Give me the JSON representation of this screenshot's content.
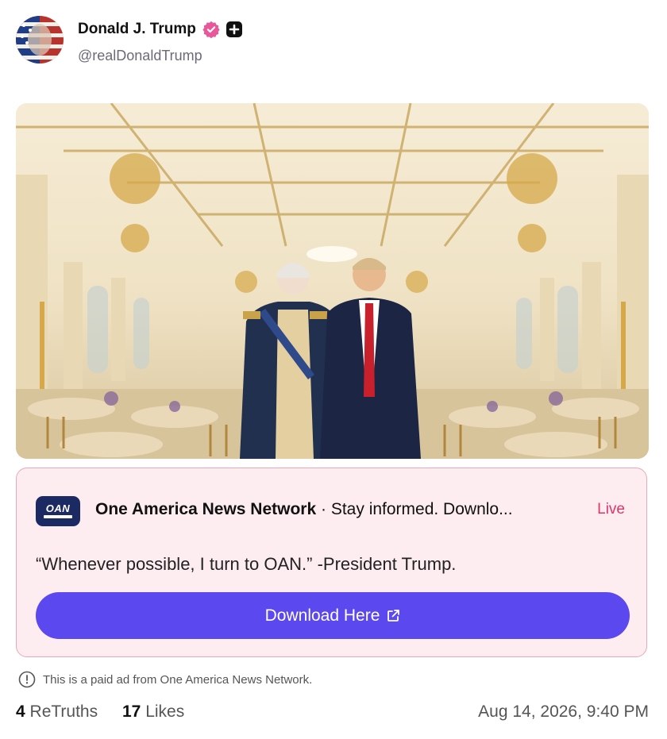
{
  "post": {
    "display_name": "Donald J. Trump",
    "handle": "@realDonaldTrump",
    "timestamp": "Aug 14, 2026, 9:40 PM"
  },
  "ad": {
    "advertiser": "One America News Network",
    "tagline": " · Stay informed. Downlo...",
    "status": "Live",
    "quote": "“Whenever possible, I turn to OAN.” -President Trump.",
    "button_label": "Download Here",
    "logo_text": "OAN",
    "disclaimer": "This is a paid ad from One America News Network."
  },
  "stats": {
    "retruths_count": "4",
    "retruths_label": "ReTruths",
    "likes_count": "17",
    "likes_label": "Likes"
  },
  "icons": {
    "verified": "verified-badge-icon",
    "plus": "plus-badge-icon",
    "external": "external-link-icon",
    "info": "info-icon"
  },
  "colors": {
    "ad_background": "#fdedf0",
    "ad_border": "#e8a8b8",
    "button": "#5b48ee",
    "live": "#e0356a",
    "verified": "#e8579a"
  }
}
